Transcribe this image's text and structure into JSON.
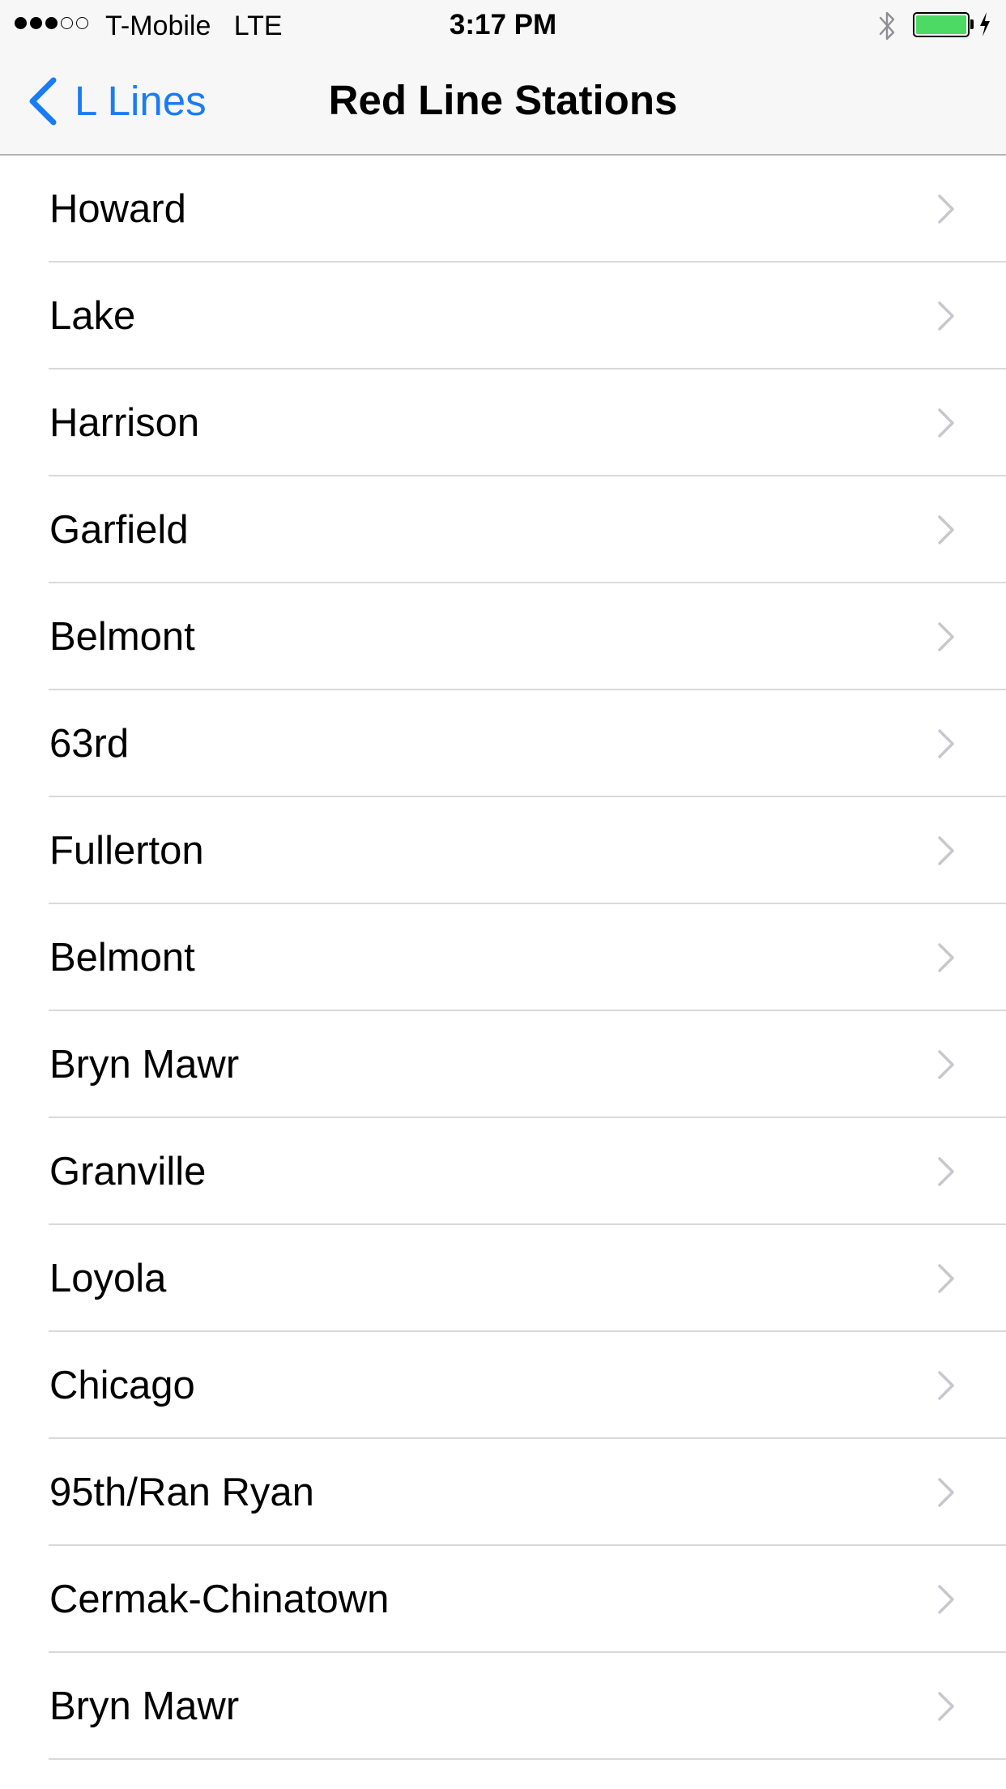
{
  "status_bar": {
    "signal_dots": [
      true,
      true,
      true,
      false,
      false
    ],
    "carrier": "T-Mobile   LTE",
    "time": "3:17 PM",
    "bluetooth_icon": "bluetooth-icon",
    "battery_level": 1.0,
    "battery_charging": true,
    "battery_color": "#4cd964"
  },
  "nav": {
    "back_label": "L Lines",
    "back_icon": "chevron-left-icon",
    "title": "Red Line Stations",
    "tint_color": "#1a7cf5"
  },
  "stations": [
    {
      "name": "Howard"
    },
    {
      "name": "Lake"
    },
    {
      "name": "Harrison"
    },
    {
      "name": "Garfield"
    },
    {
      "name": "Belmont"
    },
    {
      "name": "63rd"
    },
    {
      "name": "Fullerton"
    },
    {
      "name": "Belmont"
    },
    {
      "name": "Bryn Mawr"
    },
    {
      "name": "Granville"
    },
    {
      "name": "Loyola"
    },
    {
      "name": "Chicago"
    },
    {
      "name": "95th/Ran Ryan"
    },
    {
      "name": "Cermak-Chinatown"
    },
    {
      "name": "Bryn Mawr"
    }
  ],
  "row_disclosure_icon": "chevron-right-icon"
}
